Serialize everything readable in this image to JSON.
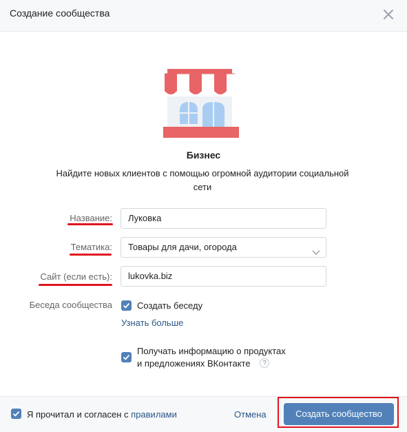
{
  "header": {
    "title": "Создание сообщества"
  },
  "community": {
    "type_name": "Бизнес",
    "description": "Найдите новых клиентов с помощью огромной аудитории социальной сети"
  },
  "form": {
    "name_label": "Название:",
    "name_value": "Луковка",
    "topic_label": "Тематика:",
    "topic_value": "Товары для дачи, огорода",
    "site_label": "Сайт (если есть):",
    "site_value": "lukovka.biz",
    "chat_label": "Беседа сообщества",
    "chat_checkbox_label": "Создать беседу",
    "learn_more_link": "Узнать больше",
    "news_checkbox_label_line1": "Получать информацию о продуктах",
    "news_checkbox_label_line2": "и предложениях ВКонтакте",
    "help_glyph": "?"
  },
  "footer": {
    "agree_text": "Я прочитал и согласен с",
    "rules_link": "правилами",
    "cancel_label": "Отмена",
    "create_label": "Создать сообщество"
  },
  "colors": {
    "accent": "#5181b8",
    "link": "#2a5885",
    "highlight_red": "#e0141e",
    "awning_red": "#e86466"
  }
}
